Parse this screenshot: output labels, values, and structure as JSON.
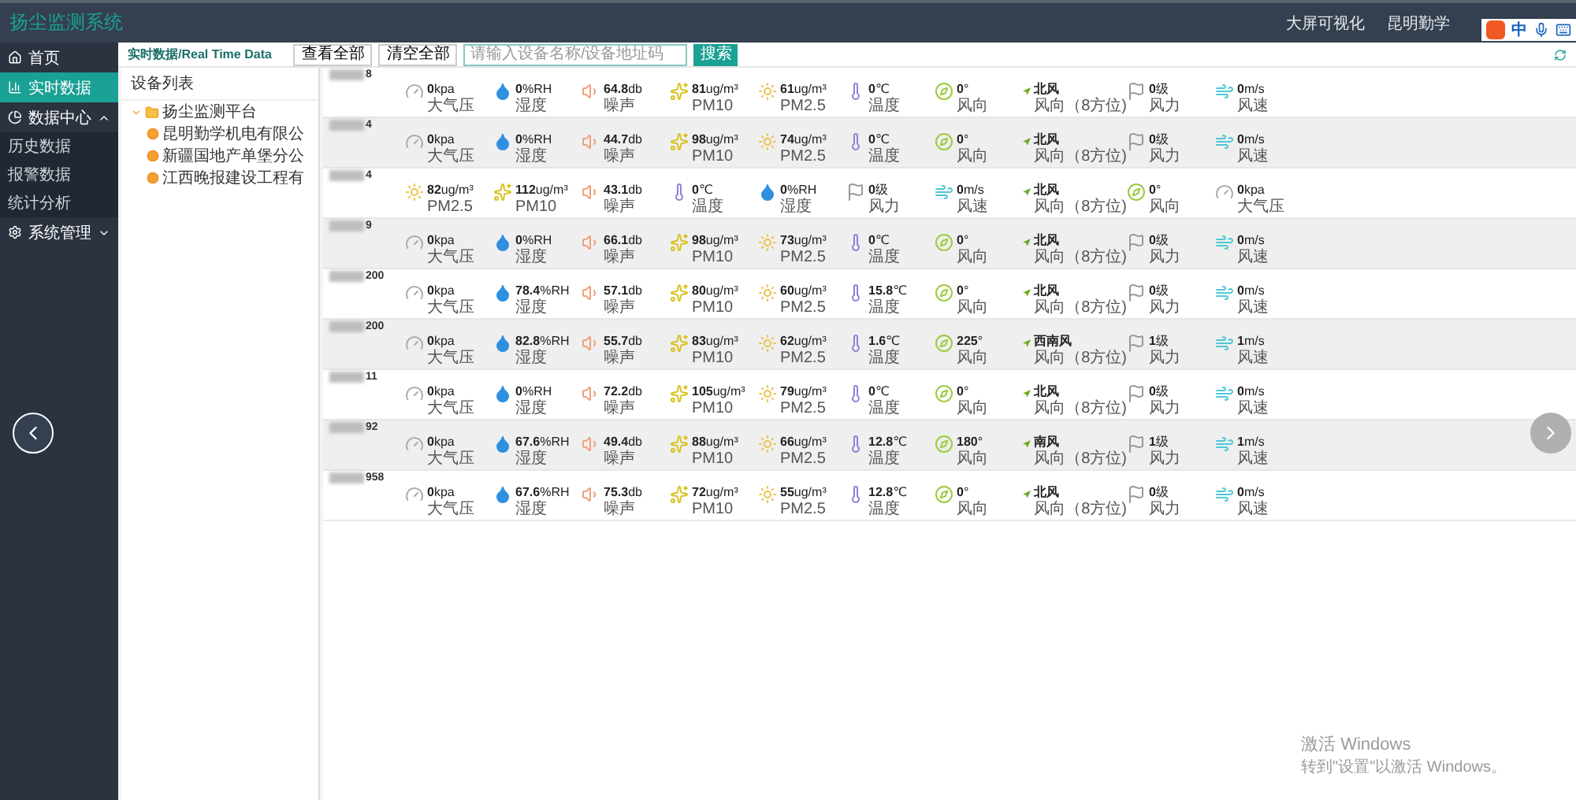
{
  "app_title": "扬尘监测系统",
  "top_links": [
    "大屏可视化",
    "昆明勤学"
  ],
  "ime": {
    "mode": "中"
  },
  "sidebar": {
    "items": [
      {
        "label": "首页",
        "kind": "home",
        "selected": false
      },
      {
        "label": "实时数据",
        "kind": "chart",
        "selected": true
      },
      {
        "label": "数据中心",
        "kind": "data",
        "selected": false,
        "expanded": true,
        "children": [
          {
            "label": "历史数据",
            "selected": false
          },
          {
            "label": "报警数据",
            "selected": false
          },
          {
            "label": "统计分析",
            "selected": false
          }
        ]
      },
      {
        "label": "系统管理",
        "kind": "settings",
        "selected": false,
        "expanded": false
      }
    ]
  },
  "toolbar": {
    "title": "实时数据/Real Time Data",
    "buttons": [
      "查看全部",
      "清空全部"
    ],
    "search": {
      "placeholder": "请输入设备名称/设备地址码"
    },
    "search_button": "搜索"
  },
  "tree": {
    "title": "设备列表",
    "nodes": [
      {
        "label": "扬尘监测平台",
        "expanded": true,
        "children": [
          {
            "label": "昆明勤学机电有限公"
          },
          {
            "label": "新疆国地产单堡分公"
          },
          {
            "label": "江西晚报建设工程有"
          }
        ]
      }
    ]
  },
  "devices": [
    {
      "name_visible": "8",
      "metrics": [
        {
          "kind": "pressure",
          "value": "0",
          "unit": "kpa",
          "label": "大气压"
        },
        {
          "kind": "humidity",
          "value": "0",
          "unit": "%RH",
          "label": "湿度"
        },
        {
          "kind": "noise",
          "value": "64.8",
          "unit": "db",
          "label": "噪声"
        },
        {
          "kind": "pm10",
          "value": "81",
          "unit": "ug/m³",
          "label": "PM10"
        },
        {
          "kind": "pm25",
          "value": "61",
          "unit": "ug/m³",
          "label": "PM2.5"
        },
        {
          "kind": "temperature",
          "value": "0",
          "unit": "℃",
          "label": "温度"
        },
        {
          "kind": "wind_angle",
          "value": "0",
          "unit": "°",
          "label": "风向"
        },
        {
          "kind": "wind_direction",
          "value": "北风",
          "label": "风向（8方位)"
        },
        {
          "kind": "wind_force",
          "value": "0",
          "unit": "级",
          "label": "风力"
        },
        {
          "kind": "wind_speed",
          "value": "0",
          "unit": "m/s",
          "label": "风速"
        }
      ]
    },
    {
      "name_visible": "4",
      "metrics": [
        {
          "kind": "pressure",
          "value": "0",
          "unit": "kpa",
          "label": "大气压"
        },
        {
          "kind": "humidity",
          "value": "0",
          "unit": "%RH",
          "label": "湿度"
        },
        {
          "kind": "noise",
          "value": "44.7",
          "unit": "db",
          "label": "噪声"
        },
        {
          "kind": "pm10",
          "value": "98",
          "unit": "ug/m³",
          "label": "PM10"
        },
        {
          "kind": "pm25",
          "value": "74",
          "unit": "ug/m³",
          "label": "PM2.5"
        },
        {
          "kind": "temperature",
          "value": "0",
          "unit": "℃",
          "label": "温度"
        },
        {
          "kind": "wind_angle",
          "value": "0",
          "unit": "°",
          "label": "风向"
        },
        {
          "kind": "wind_direction",
          "value": "北风",
          "label": "风向（8方位)"
        },
        {
          "kind": "wind_force",
          "value": "0",
          "unit": "级",
          "label": "风力"
        },
        {
          "kind": "wind_speed",
          "value": "0",
          "unit": "m/s",
          "label": "风速"
        }
      ]
    },
    {
      "name_visible": "4",
      "metrics": [
        {
          "kind": "pm25",
          "value": "82",
          "unit": "ug/m³",
          "label": "PM2.5"
        },
        {
          "kind": "pm10",
          "value": "112",
          "unit": "ug/m³",
          "label": "PM10"
        },
        {
          "kind": "noise",
          "value": "43.1",
          "unit": "db",
          "label": "噪声"
        },
        {
          "kind": "temperature",
          "value": "0",
          "unit": "℃",
          "label": "温度"
        },
        {
          "kind": "humidity",
          "value": "0",
          "unit": "%RH",
          "label": "湿度"
        },
        {
          "kind": "wind_force",
          "value": "0",
          "unit": "级",
          "label": "风力"
        },
        {
          "kind": "wind_speed",
          "value": "0",
          "unit": "m/s",
          "label": "风速"
        },
        {
          "kind": "wind_direction",
          "value": "北风",
          "label": "风向（8方位)"
        },
        {
          "kind": "wind_angle",
          "value": "0",
          "unit": "°",
          "label": "风向"
        },
        {
          "kind": "pressure",
          "value": "0",
          "unit": "kpa",
          "label": "大气压"
        }
      ]
    },
    {
      "name_visible": "9",
      "metrics": [
        {
          "kind": "pressure",
          "value": "0",
          "unit": "kpa",
          "label": "大气压"
        },
        {
          "kind": "humidity",
          "value": "0",
          "unit": "%RH",
          "label": "湿度"
        },
        {
          "kind": "noise",
          "value": "66.1",
          "unit": "db",
          "label": "噪声"
        },
        {
          "kind": "pm10",
          "value": "98",
          "unit": "ug/m³",
          "label": "PM10"
        },
        {
          "kind": "pm25",
          "value": "73",
          "unit": "ug/m³",
          "label": "PM2.5"
        },
        {
          "kind": "temperature",
          "value": "0",
          "unit": "℃",
          "label": "温度"
        },
        {
          "kind": "wind_angle",
          "value": "0",
          "unit": "°",
          "label": "风向"
        },
        {
          "kind": "wind_direction",
          "value": "北风",
          "label": "风向（8方位)"
        },
        {
          "kind": "wind_force",
          "value": "0",
          "unit": "级",
          "label": "风力"
        },
        {
          "kind": "wind_speed",
          "value": "0",
          "unit": "m/s",
          "label": "风速"
        }
      ]
    },
    {
      "name_visible": "200",
      "metrics": [
        {
          "kind": "pressure",
          "value": "0",
          "unit": "kpa",
          "label": "大气压"
        },
        {
          "kind": "humidity",
          "value": "78.4",
          "unit": "%RH",
          "label": "湿度"
        },
        {
          "kind": "noise",
          "value": "57.1",
          "unit": "db",
          "label": "噪声"
        },
        {
          "kind": "pm10",
          "value": "80",
          "unit": "ug/m³",
          "label": "PM10"
        },
        {
          "kind": "pm25",
          "value": "60",
          "unit": "ug/m³",
          "label": "PM2.5"
        },
        {
          "kind": "temperature",
          "value": "15.8",
          "unit": "℃",
          "label": "温度"
        },
        {
          "kind": "wind_angle",
          "value": "0",
          "unit": "°",
          "label": "风向"
        },
        {
          "kind": "wind_direction",
          "value": "北风",
          "label": "风向（8方位)"
        },
        {
          "kind": "wind_force",
          "value": "0",
          "unit": "级",
          "label": "风力"
        },
        {
          "kind": "wind_speed",
          "value": "0",
          "unit": "m/s",
          "label": "风速"
        }
      ]
    },
    {
      "name_visible": "200",
      "metrics": [
        {
          "kind": "pressure",
          "value": "0",
          "unit": "kpa",
          "label": "大气压"
        },
        {
          "kind": "humidity",
          "value": "82.8",
          "unit": "%RH",
          "label": "湿度"
        },
        {
          "kind": "noise",
          "value": "55.7",
          "unit": "db",
          "label": "噪声"
        },
        {
          "kind": "pm10",
          "value": "83",
          "unit": "ug/m³",
          "label": "PM10"
        },
        {
          "kind": "pm25",
          "value": "62",
          "unit": "ug/m³",
          "label": "PM2.5"
        },
        {
          "kind": "temperature",
          "value": "1.6",
          "unit": "℃",
          "label": "温度"
        },
        {
          "kind": "wind_angle",
          "value": "225",
          "unit": "°",
          "label": "风向"
        },
        {
          "kind": "wind_direction",
          "value": "西南风",
          "label": "风向（8方位)"
        },
        {
          "kind": "wind_force",
          "value": "1",
          "unit": "级",
          "label": "风力"
        },
        {
          "kind": "wind_speed",
          "value": "1",
          "unit": "m/s",
          "label": "风速"
        }
      ]
    },
    {
      "name_visible": "11",
      "metrics": [
        {
          "kind": "pressure",
          "value": "0",
          "unit": "kpa",
          "label": "大气压"
        },
        {
          "kind": "humidity",
          "value": "0",
          "unit": "%RH",
          "label": "湿度"
        },
        {
          "kind": "noise",
          "value": "72.2",
          "unit": "db",
          "label": "噪声"
        },
        {
          "kind": "pm10",
          "value": "105",
          "unit": "ug/m³",
          "label": "PM10"
        },
        {
          "kind": "pm25",
          "value": "79",
          "unit": "ug/m³",
          "label": "PM2.5"
        },
        {
          "kind": "temperature",
          "value": "0",
          "unit": "℃",
          "label": "温度"
        },
        {
          "kind": "wind_angle",
          "value": "0",
          "unit": "°",
          "label": "风向"
        },
        {
          "kind": "wind_direction",
          "value": "北风",
          "label": "风向（8方位)"
        },
        {
          "kind": "wind_force",
          "value": "0",
          "unit": "级",
          "label": "风力"
        },
        {
          "kind": "wind_speed",
          "value": "0",
          "unit": "m/s",
          "label": "风速"
        }
      ]
    },
    {
      "name_visible": "92",
      "metrics": [
        {
          "kind": "pressure",
          "value": "0",
          "unit": "kpa",
          "label": "大气压"
        },
        {
          "kind": "humidity",
          "value": "67.6",
          "unit": "%RH",
          "label": "湿度"
        },
        {
          "kind": "noise",
          "value": "49.4",
          "unit": "db",
          "label": "噪声"
        },
        {
          "kind": "pm10",
          "value": "88",
          "unit": "ug/m³",
          "label": "PM10"
        },
        {
          "kind": "pm25",
          "value": "66",
          "unit": "ug/m³",
          "label": "PM2.5"
        },
        {
          "kind": "temperature",
          "value": "12.8",
          "unit": "℃",
          "label": "温度"
        },
        {
          "kind": "wind_angle",
          "value": "180",
          "unit": "°",
          "label": "风向"
        },
        {
          "kind": "wind_direction",
          "value": "南风",
          "label": "风向（8方位)"
        },
        {
          "kind": "wind_force",
          "value": "1",
          "unit": "级",
          "label": "风力"
        },
        {
          "kind": "wind_speed",
          "value": "1",
          "unit": "m/s",
          "label": "风速"
        }
      ]
    },
    {
      "name_visible": "958",
      "metrics": [
        {
          "kind": "pressure",
          "value": "0",
          "unit": "kpa",
          "label": "大气压"
        },
        {
          "kind": "humidity",
          "value": "67.6",
          "unit": "%RH",
          "label": "湿度"
        },
        {
          "kind": "noise",
          "value": "75.3",
          "unit": "db",
          "label": "噪声"
        },
        {
          "kind": "pm10",
          "value": "72",
          "unit": "ug/m³",
          "label": "PM10"
        },
        {
          "kind": "pm25",
          "value": "55",
          "unit": "ug/m³",
          "label": "PM2.5"
        },
        {
          "kind": "temperature",
          "value": "12.8",
          "unit": "℃",
          "label": "温度"
        },
        {
          "kind": "wind_angle",
          "value": "0",
          "unit": "°",
          "label": "风向"
        },
        {
          "kind": "wind_direction",
          "value": "北风",
          "label": "风向（8方位)"
        },
        {
          "kind": "wind_force",
          "value": "0",
          "unit": "级",
          "label": "风力"
        },
        {
          "kind": "wind_speed",
          "value": "0",
          "unit": "m/s",
          "label": "风速"
        }
      ]
    }
  ],
  "windows_notice": {
    "title": "激活 Windows",
    "text": "转到\"设置\"以激活 Windows。"
  }
}
